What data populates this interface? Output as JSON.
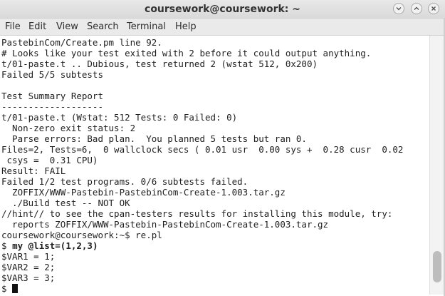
{
  "window": {
    "title": "coursework@coursework: ~"
  },
  "menubar": {
    "items": [
      {
        "label": "File"
      },
      {
        "label": "Edit"
      },
      {
        "label": "View"
      },
      {
        "label": "Search"
      },
      {
        "label": "Terminal"
      },
      {
        "label": "Help"
      }
    ]
  },
  "terminal": {
    "lines": [
      {
        "prefix": "",
        "text": "PastebinCom/Create.pm line 92."
      },
      {
        "prefix": "",
        "text": "# Looks like your test exited with 2 before it could output anything."
      },
      {
        "prefix": "",
        "text": "t/01-paste.t .. Dubious, test returned 2 (wstat 512, 0x200)"
      },
      {
        "prefix": "",
        "text": "Failed 5/5 subtests"
      },
      {
        "prefix": "",
        "text": ""
      },
      {
        "prefix": "",
        "text": "Test Summary Report"
      },
      {
        "prefix": "",
        "text": "-------------------"
      },
      {
        "prefix": "",
        "text": "t/01-paste.t (Wstat: 512 Tests: 0 Failed: 0)"
      },
      {
        "prefix": "",
        "text": "  Non-zero exit status: 2"
      },
      {
        "prefix": "",
        "text": "  Parse errors: Bad plan.  You planned 5 tests but ran 0."
      },
      {
        "prefix": "",
        "text": "Files=2, Tests=6,  0 wallclock secs ( 0.01 usr  0.00 sys +  0.28 cusr  0.02"
      },
      {
        "prefix": "",
        "text": " csys =  0.31 CPU)"
      },
      {
        "prefix": "",
        "text": "Result: FAIL"
      },
      {
        "prefix": "",
        "text": "Failed 1/2 test programs. 0/6 subtests failed."
      },
      {
        "prefix": "",
        "text": "  ZOFFIX/WWW-Pastebin-PastebinCom-Create-1.003.tar.gz"
      },
      {
        "prefix": "",
        "text": "  ./Build test -- NOT OK"
      },
      {
        "prefix": "",
        "text": "//hint// to see the cpan-testers results for installing this module, try:"
      },
      {
        "prefix": "",
        "text": "  reports ZOFFIX/WWW-Pastebin-PastebinCom-Create-1.003.tar.gz"
      },
      {
        "prefix": "",
        "text": "coursework@coursework:~$ re.pl"
      },
      {
        "prefix": "$ ",
        "text": "my @list=(1,2,3)",
        "bold": true
      },
      {
        "prefix": "",
        "text": "$VAR1 = 1;"
      },
      {
        "prefix": "",
        "text": "$VAR2 = 2;"
      },
      {
        "prefix": "",
        "text": "$VAR3 = 3;"
      },
      {
        "prefix": "$ ",
        "text": "",
        "cursor": true
      }
    ]
  },
  "colors": {
    "terminal_background": "#ffffff",
    "terminal_foreground": "#1f1f1f",
    "titlebar": "#dadada",
    "menubar": "#eaeaea"
  },
  "icons": {
    "minimize": "chevron-down-icon",
    "maximize": "chevron-up-icon",
    "close": "close-icon"
  }
}
